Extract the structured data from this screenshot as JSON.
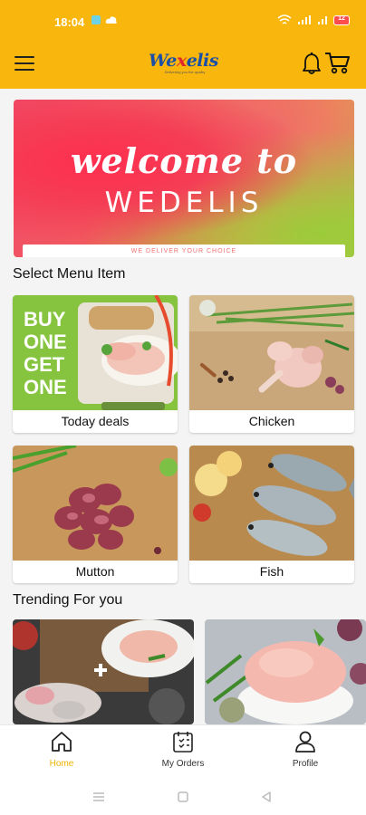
{
  "status_bar": {
    "time": "18:04",
    "battery": "12"
  },
  "app_bar": {
    "logo_text_pre": "We",
    "logo_text_x": "x",
    "logo_text_post": "elis",
    "logo_tagline": "Delivering you the quality",
    "icons": [
      "menu-icon",
      "bell-icon",
      "cart-icon"
    ]
  },
  "banner": {
    "welcome": "welcome to",
    "brand": "WEDELIS",
    "tagline": "WE DELIVER YOUR CHOICE"
  },
  "menu_section": {
    "title": "Select Menu Item",
    "items": [
      {
        "label": "Today deals",
        "promo_lines": [
          "BUY",
          "ONE",
          "GET",
          "ONE"
        ]
      },
      {
        "label": "Chicken"
      },
      {
        "label": "Mutton"
      },
      {
        "label": "Fish"
      }
    ]
  },
  "trending_section": {
    "title": "Trending For you"
  },
  "bottom_nav": {
    "items": [
      {
        "label": "Home",
        "icon": "home-icon",
        "active": true
      },
      {
        "label": "My Orders",
        "icon": "orders-icon",
        "active": false
      },
      {
        "label": "Profile",
        "icon": "profile-icon",
        "active": false
      }
    ]
  },
  "colors": {
    "brand_yellow": "#f9b70e",
    "active_nav": "#f2b200",
    "logo_blue": "#1b4fa6",
    "logo_red": "#e2262b"
  }
}
